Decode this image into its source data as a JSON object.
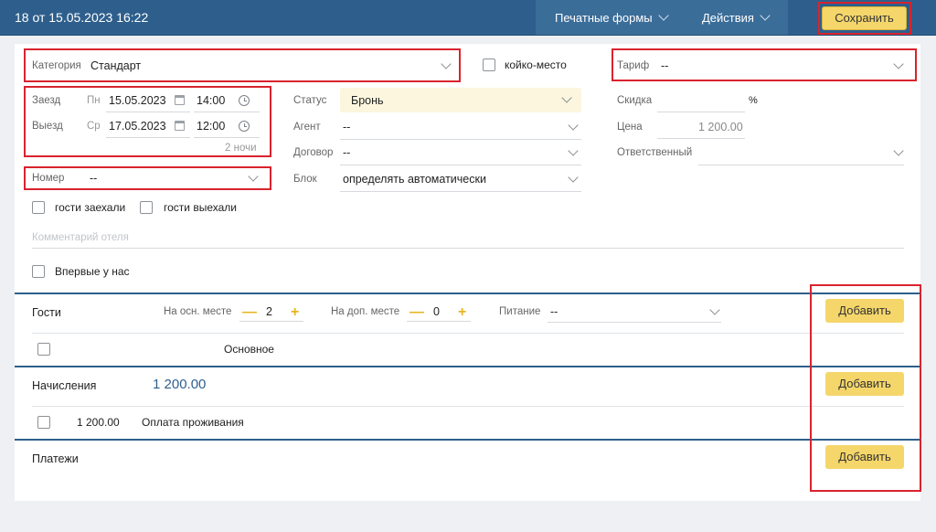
{
  "header": {
    "title": "18 от 15.05.2023 16:22",
    "print_forms": "Печатные формы",
    "actions": "Действия",
    "save": "Сохранить"
  },
  "form": {
    "category": {
      "label": "Категория",
      "value": "Стандарт"
    },
    "bed_place": {
      "label": "койко-место",
      "checked": false
    },
    "tariff": {
      "label": "Тариф",
      "value": "--"
    },
    "checkin": {
      "label": "Заезд",
      "weekday": "Пн",
      "date": "15.05.2023",
      "time": "14:00"
    },
    "checkout": {
      "label": "Выезд",
      "weekday": "Ср",
      "date": "17.05.2023",
      "time": "12:00"
    },
    "nights": "2 ночи",
    "room": {
      "label": "Номер",
      "value": "--"
    },
    "status": {
      "label": "Статус",
      "value": "Бронь"
    },
    "agent": {
      "label": "Агент",
      "value": "--"
    },
    "contract": {
      "label": "Договор",
      "value": "--"
    },
    "block": {
      "label": "Блок",
      "value": "определять автоматически"
    },
    "discount": {
      "label": "Скидка",
      "value": "",
      "unit": "%"
    },
    "price": {
      "label": "Цена",
      "value": "1 200.00"
    },
    "responsible": {
      "label": "Ответственный",
      "value": ""
    },
    "guests_checked_in": {
      "label": "гости заехали",
      "checked": false
    },
    "guests_checked_out": {
      "label": "гости выехали",
      "checked": false
    },
    "hotel_comment": {
      "placeholder": "Комментарий отеля"
    },
    "first_time": {
      "label": "Впервые у нас",
      "checked": false
    }
  },
  "guests": {
    "title": "Гости",
    "main_place_label": "На осн. месте",
    "main_place_count": "2",
    "extra_place_label": "На доп. месте",
    "extra_place_count": "0",
    "meal_label": "Питание",
    "meal_value": "--",
    "add": "Добавить",
    "column_main": "Основное",
    "minus": "—",
    "plus": "+"
  },
  "charges": {
    "title": "Начисления",
    "total": "1 200.00",
    "add": "Добавить",
    "rows": [
      {
        "amount": "1 200.00",
        "description": "Оплата проживания"
      }
    ]
  },
  "payments": {
    "title": "Платежи",
    "add": "Добавить"
  },
  "colors": {
    "header_bg": "#2e5f8c",
    "accent_button": "#f5d66a",
    "highlight_box": "#d9232e",
    "status_bg": "#fbf6dd"
  }
}
